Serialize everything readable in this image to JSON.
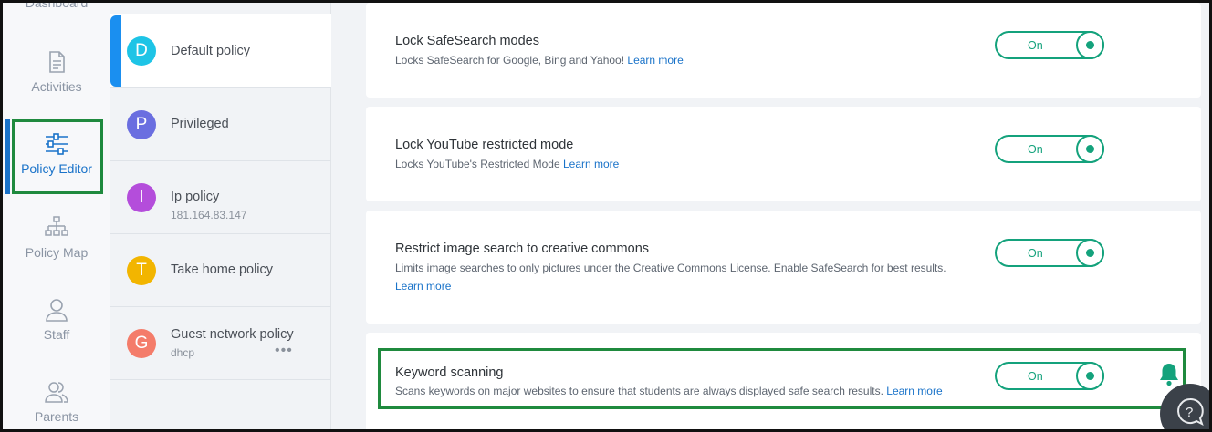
{
  "nav": {
    "items": [
      {
        "label": "Dashboard",
        "icon": "dashboard-icon"
      },
      {
        "label": "Activities",
        "icon": "document-icon"
      },
      {
        "label": "Policy Editor",
        "icon": "sliders-icon",
        "active": true
      },
      {
        "label": "Policy Map",
        "icon": "sitemap-icon"
      },
      {
        "label": "Staff",
        "icon": "user-icon"
      },
      {
        "label": "Parents",
        "icon": "users-icon"
      }
    ]
  },
  "policies": {
    "items": [
      {
        "initial": "D",
        "name": "Default policy",
        "sub": "",
        "color": "#1ec4e6",
        "selected": true
      },
      {
        "initial": "P",
        "name": "Privileged",
        "sub": "",
        "color": "#6a6ee0"
      },
      {
        "initial": "I",
        "name": "Ip policy",
        "sub": "181.164.83.147",
        "color": "#b44ddb"
      },
      {
        "initial": "T",
        "name": "Take home policy",
        "sub": "",
        "color": "#f2b500"
      },
      {
        "initial": "G",
        "name": "Guest network policy",
        "sub": "dhcp",
        "color": "#f47c6a",
        "more": "•••"
      }
    ]
  },
  "settings": {
    "items": [
      {
        "title": "Lock SafeSearch modes",
        "desc": "Locks SafeSearch for Google, Bing and Yahoo!",
        "link": "Learn more",
        "toggle": "On"
      },
      {
        "title": "Lock YouTube restricted mode",
        "desc": "Locks YouTube's Restricted Mode",
        "link": "Learn more",
        "toggle": "On"
      },
      {
        "title": "Restrict image search to creative commons",
        "desc": "Limits image searches to only pictures under the Creative Commons License. Enable SafeSearch for best results.",
        "link": "Learn more",
        "toggle": "On"
      },
      {
        "title": "Keyword scanning",
        "desc": "Scans keywords on major websites to ensure that students are always displayed safe search results.",
        "link": "Learn more",
        "toggle": "On",
        "bell": "bell-icon"
      }
    ]
  },
  "help": {
    "icon": "help-chat-icon",
    "glyph": "?"
  },
  "colors": {
    "accent": "#1a73c9",
    "toggle": "#14a27c",
    "highlight": "#1f8a3e"
  }
}
